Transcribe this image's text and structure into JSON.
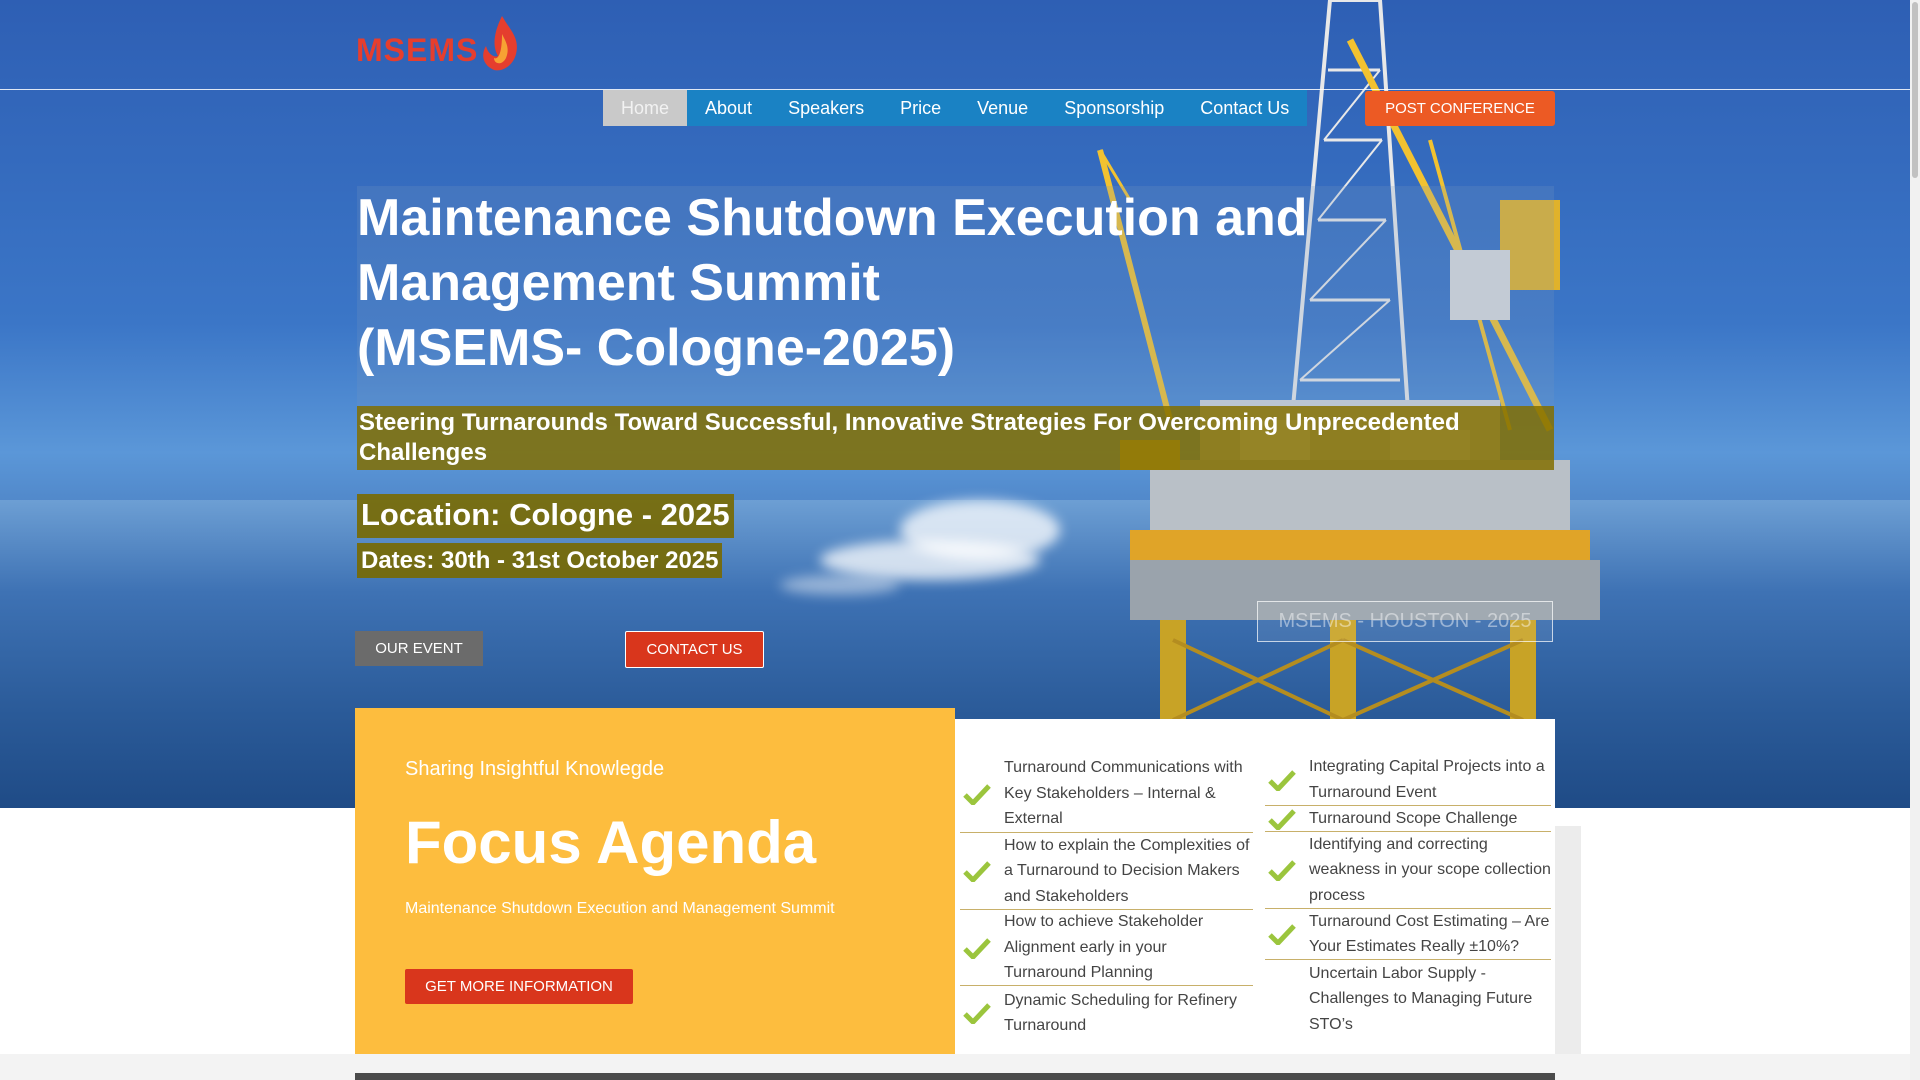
{
  "logo": {
    "text": "MSEMS"
  },
  "nav": {
    "items": [
      {
        "label": "Home",
        "active": true
      },
      {
        "label": "About"
      },
      {
        "label": "Speakers"
      },
      {
        "label": "Price"
      },
      {
        "label": "Venue"
      },
      {
        "label": "Sponsorship"
      },
      {
        "label": "Contact Us"
      }
    ],
    "post_conference": "POST CONFERENCE"
  },
  "hero": {
    "title_line1": "Maintenance Shutdown Execution and",
    "title_line2": "Management Summit",
    "title_line3": "(MSEMS- Cologne-2025)",
    "subtitle": "Steering Turnarounds Toward Successful, Innovative Strategies For Overcoming Unprecedented Challenges",
    "location": "Location: Cologne - 2025",
    "dates": "Dates: 30th - 31st October 2025",
    "our_event": "OUR EVENT",
    "contact_us": "CONTACT US",
    "houston": "MSEMS - HOUSTON - 2025"
  },
  "focus": {
    "kicker": "Sharing Insightful Knowlegde",
    "heading": "Focus Agenda",
    "description": "Maintenance Shutdown Execution and Management Summit",
    "button": "GET MORE INFORMATION"
  },
  "agenda": {
    "left": [
      "Turnaround Communications with Key Stakeholders – Internal & External",
      "How to explain the Complexities of a Turnaround to Decision Makers and Stakeholders",
      "How to achieve Stakeholder Alignment early in your Turnaround Planning",
      "Dynamic Scheduling for Refinery Turnaround"
    ],
    "right": [
      "Integrating Capital Projects into a Turnaround Event",
      "Turnaround Scope Challenge",
      "Identifying and correcting weakness in your scope collection process",
      "Turnaround Cost Estimating – Are Your Estimates Really ±10%?",
      "Uncertain Labor Supply - Challenges to Managing Future STO’s"
    ]
  },
  "colors": {
    "nav_blue": "#1a82c4",
    "accent_orange": "#ec5a24",
    "accent_red": "#d9361c",
    "focus_yellow": "#fdbd3e",
    "olive": "#827000",
    "check_green": "#9bc53d"
  },
  "icons": {
    "check": "check-icon",
    "flame": "flame-icon"
  }
}
